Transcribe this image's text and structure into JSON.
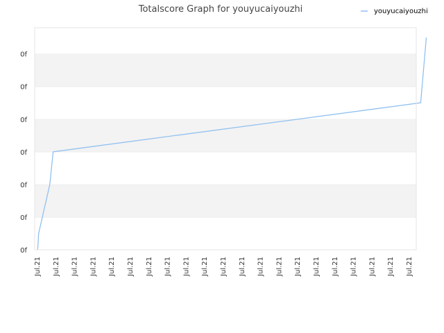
{
  "chart_data": {
    "type": "line",
    "title": "Totalscore Graph for youyucaiyouzhi",
    "xlabel": "",
    "ylabel": "",
    "legend_position": "top-right",
    "grid": true,
    "band_colors": [
      "#ffffff",
      "#f3f3f3"
    ],
    "y_tick_labels": [
      "0f",
      "0f",
      "0f",
      "0f",
      "0f",
      "0f",
      "0f"
    ],
    "ylim": [
      0,
      6.8
    ],
    "categories": [
      "Jul.21",
      "Jul.21",
      "Jul.21",
      "Jul.21",
      "Jul.21",
      "Jul.21",
      "Jul.21",
      "Jul.21",
      "Jul.21",
      "Jul.21",
      "Jul.21",
      "Jul.21",
      "Jul.21",
      "Jul.21",
      "Jul.21",
      "Jul.21",
      "Jul.21",
      "Jul.21",
      "Jul.21",
      "Jul.21",
      "Jul.21"
    ],
    "series": [
      {
        "name": "youyucaiyouzhi",
        "color": "#90c0f0",
        "x": [
          0.05,
          0.1,
          0.7,
          0.88,
          20.65,
          20.95
        ],
        "values": [
          0.0,
          0.5,
          2.0,
          3.0,
          4.5,
          6.5
        ]
      }
    ]
  }
}
